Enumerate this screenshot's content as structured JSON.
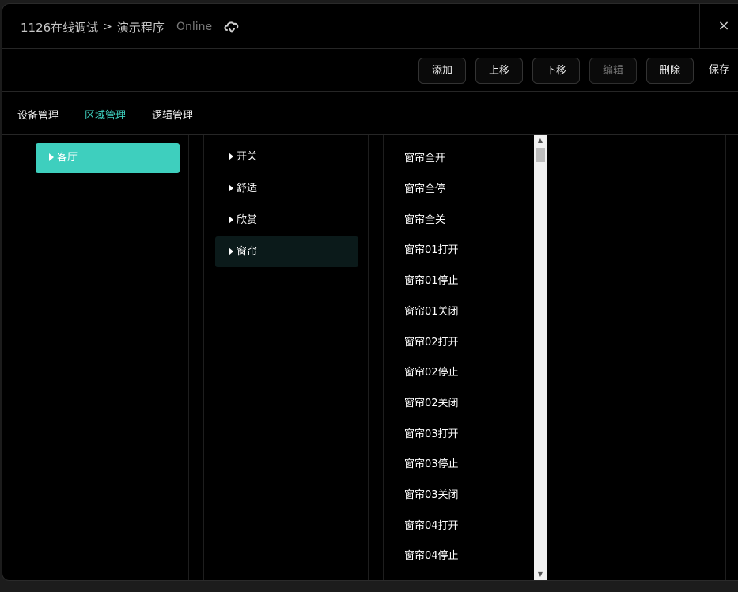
{
  "header": {
    "project": "1126在线调试",
    "separator": ">",
    "program": "演示程序",
    "status": "Online",
    "cloud_icon": "cloud-sync-icon",
    "close_icon": "close-icon",
    "close_label": "×"
  },
  "toolbar": {
    "add": "添加",
    "move_up": "上移",
    "move_down": "下移",
    "edit": "编辑",
    "delete": "删除",
    "save": "保存"
  },
  "tabs": [
    {
      "label": "设备管理",
      "active": false
    },
    {
      "label": "区域管理",
      "active": true
    },
    {
      "label": "逻辑管理",
      "active": false
    }
  ],
  "areas": [
    {
      "label": "客厅",
      "selected": true
    }
  ],
  "groups": [
    {
      "label": "开关",
      "selected": false
    },
    {
      "label": "舒适",
      "selected": false
    },
    {
      "label": "欣赏",
      "selected": false
    },
    {
      "label": "窗帘",
      "selected": true
    }
  ],
  "scenes": [
    "窗帘全开",
    "窗帘全停",
    "窗帘全关",
    "窗帘01打开",
    "窗帘01停止",
    "窗帘01关闭",
    "窗帘02打开",
    "窗帘02停止",
    "窗帘02关闭",
    "窗帘03打开",
    "窗帘03停止",
    "窗帘03关闭",
    "窗帘04打开",
    "窗帘04停止"
  ],
  "scrollbar": {
    "up": "▲",
    "down": "▼"
  },
  "colors": {
    "accent": "#3ecfbe",
    "background": "#000000",
    "selected_row": "#0b1a1a"
  }
}
